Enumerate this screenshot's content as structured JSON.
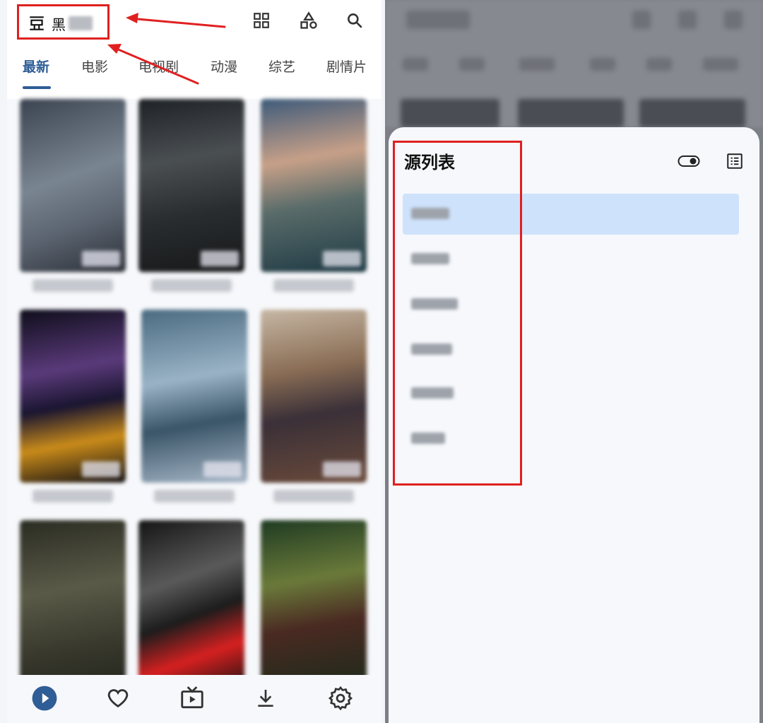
{
  "left": {
    "app": {
      "name": "黑",
      "logo_icon": "tv-box-icon"
    },
    "top_actions": [
      {
        "name": "grid-view-icon"
      },
      {
        "name": "shapes-icon"
      },
      {
        "name": "search-icon"
      }
    ],
    "tabs": [
      "最新",
      "电影",
      "电视剧",
      "动漫",
      "综艺",
      "剧情片"
    ],
    "active_tab": "最新",
    "bottom_nav": [
      {
        "name": "play-icon",
        "active": true
      },
      {
        "name": "heart-icon",
        "active": false
      },
      {
        "name": "tv-icon",
        "active": false
      },
      {
        "name": "download-icon",
        "active": false
      },
      {
        "name": "gear-icon",
        "active": false
      }
    ]
  },
  "right": {
    "sheet_title": "源列表",
    "header_icons": [
      "toggle-icon",
      "list-icon"
    ],
    "active_source_index": 0
  },
  "colors": {
    "accent": "#2f5d96",
    "annotation": "#e02020",
    "selected_row": "#cfe2fb"
  }
}
